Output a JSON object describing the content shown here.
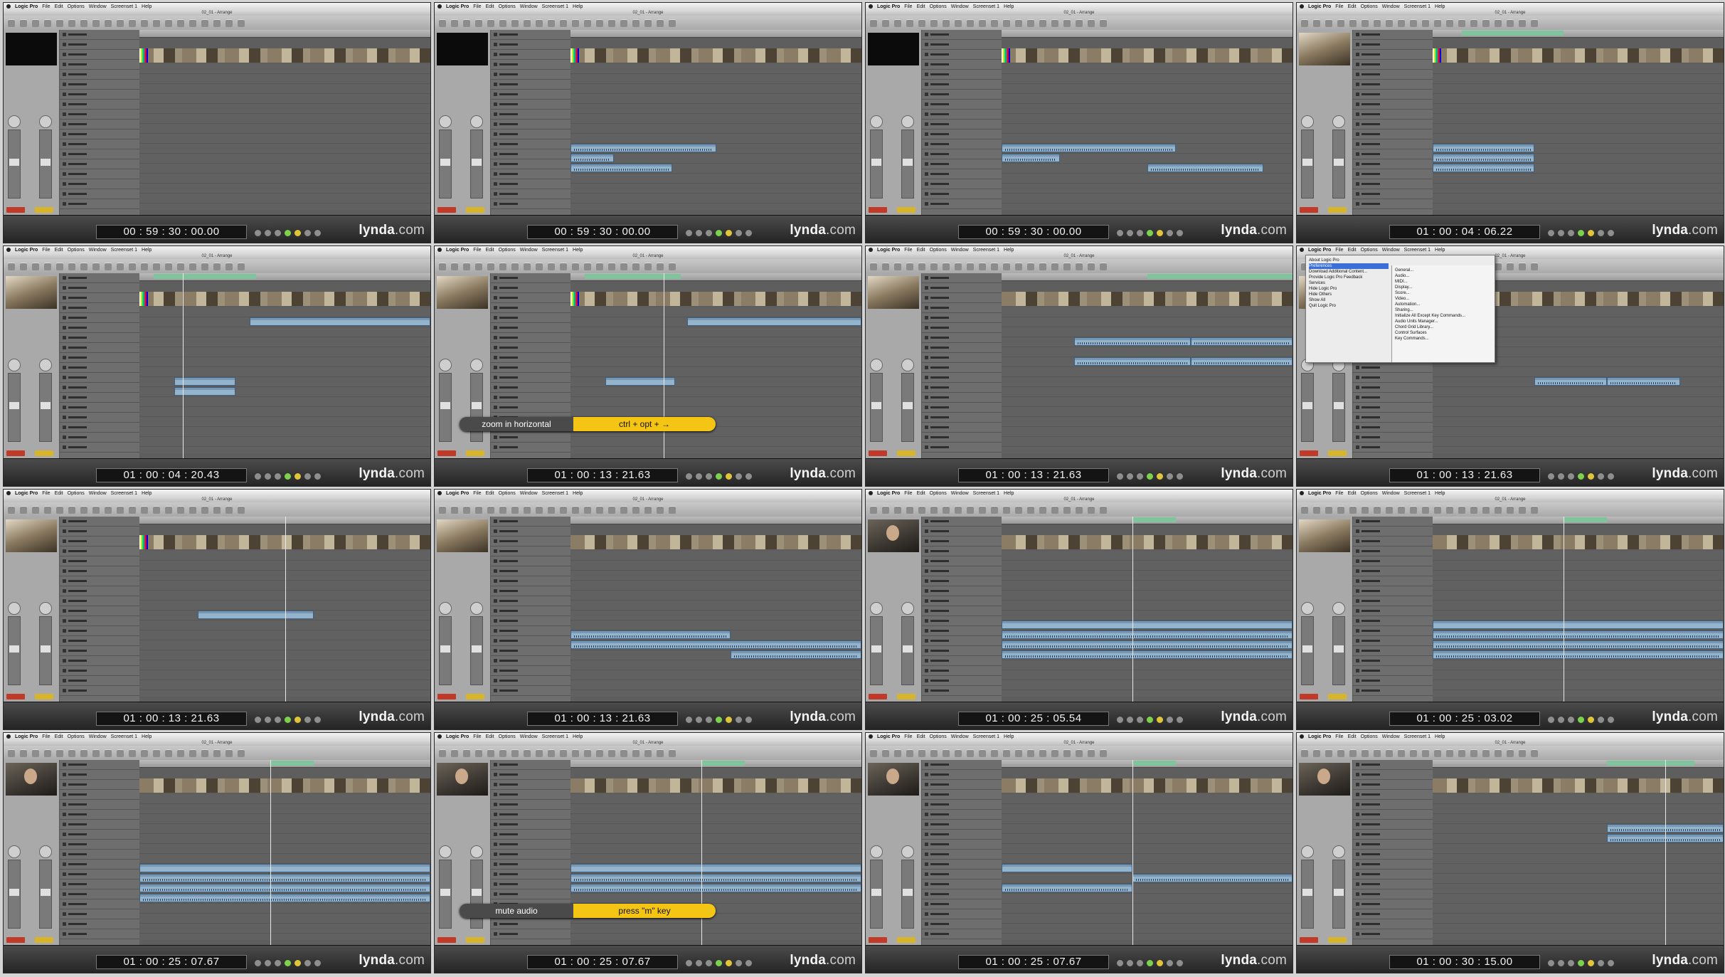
{
  "menu": {
    "app_name": "Logic Pro",
    "items": [
      "File",
      "Edit",
      "Options",
      "Window",
      "Screenset 1",
      "Help"
    ]
  },
  "window_title": "02_01 - Arrange",
  "logo": {
    "main": "lynda",
    "suffix": ".com"
  },
  "thumbnails": [
    {
      "timecode": "00 : 59 : 30 : 00.00",
      "video": "black",
      "bars": true,
      "cycle": null,
      "playhead": null,
      "regions": []
    },
    {
      "timecode": "00 : 59 : 30 : 00.00",
      "video": "black",
      "bars": true,
      "cycle": null,
      "playhead": null,
      "regions": [
        [
          0,
          8,
          0.5,
          0.62
        ],
        [
          0,
          9,
          0.15,
          0.85
        ],
        [
          0,
          10,
          0.35,
          1.0
        ]
      ]
    },
    {
      "timecode": "00 : 59 : 30 : 00.00",
      "video": "black",
      "bars": true,
      "cycle": null,
      "playhead": null,
      "regions": [
        [
          0,
          8,
          0.6,
          0.8
        ],
        [
          0,
          9,
          0.2,
          1.0
        ],
        [
          0.5,
          10,
          0.9,
          1.0
        ]
      ]
    },
    {
      "timecode": "01 : 00 : 04 : 06.22",
      "video": "room",
      "bars": true,
      "cycle": [
        0.1,
        0.45
      ],
      "playhead": null,
      "regions": [
        [
          0,
          8,
          0.35,
          1.0
        ],
        [
          0,
          9,
          0.35,
          1.0
        ],
        [
          0,
          10,
          0.35,
          1.0
        ]
      ]
    },
    {
      "timecode": "01 : 00 : 04 : 20.43",
      "video": "room",
      "bars": true,
      "cycle": [
        0.05,
        0.4
      ],
      "playhead": 0.15,
      "regions": [
        [
          0.38,
          1,
          1.0,
          0
        ],
        [
          0.12,
          7,
          0.33,
          0
        ],
        [
          0.12,
          8,
          0.33,
          0
        ]
      ]
    },
    {
      "timecode": "01 : 00 : 13 : 21.63",
      "video": "room",
      "bars": true,
      "cycle": [
        0.05,
        0.38
      ],
      "playhead": 0.32,
      "regions": [
        [
          0.4,
          1,
          1.0,
          0
        ],
        [
          0.12,
          7,
          0.36,
          0
        ]
      ]
    },
    {
      "timecode": "01 : 00 : 13 : 21.63",
      "video": "room",
      "bars": false,
      "cycle": [
        0.5,
        1.0
      ],
      "playhead": null,
      "regions": [
        [
          0.25,
          3,
          0.65,
          1
        ],
        [
          0.25,
          5,
          0.65,
          1
        ],
        [
          0.65,
          3,
          1.0,
          1
        ],
        [
          0.65,
          5,
          1.0,
          1
        ]
      ]
    },
    {
      "timecode": "01 : 00 : 13 : 21.63",
      "video": "room",
      "bars": false,
      "cycle": null,
      "playhead": null,
      "regions": [
        [
          0.35,
          7,
          0.6,
          1
        ],
        [
          0.6,
          7,
          0.85,
          1
        ]
      ]
    },
    {
      "timecode": "01 : 00 : 13 : 21.63",
      "video": "room",
      "bars": true,
      "cycle": null,
      "playhead": 0.5,
      "regions": [
        [
          0.2,
          6,
          0.6,
          0
        ]
      ]
    },
    {
      "timecode": "01 : 00 : 13 : 21.63",
      "video": "room",
      "bars": false,
      "cycle": null,
      "playhead": null,
      "regions": [
        [
          0,
          8,
          0.55,
          1
        ],
        [
          0,
          9,
          1.0,
          1
        ],
        [
          0.55,
          10,
          1.0,
          1
        ]
      ]
    },
    {
      "timecode": "01 : 00 : 25 : 05.54",
      "video": "person",
      "bars": false,
      "cycle": [
        0.45,
        0.6
      ],
      "playhead": 0.45,
      "regions": [
        [
          0,
          7,
          1.0,
          0
        ],
        [
          0,
          8,
          1.0,
          1
        ],
        [
          0,
          9,
          1.0,
          1
        ],
        [
          0,
          10,
          1.0,
          1
        ]
      ]
    },
    {
      "timecode": "01 : 00 : 25 : 03.02",
      "video": "room",
      "bars": false,
      "cycle": [
        0.45,
        0.6
      ],
      "playhead": 0.45,
      "regions": [
        [
          0,
          7,
          1.0,
          0
        ],
        [
          0,
          8,
          1.0,
          1
        ],
        [
          0,
          9,
          1.0,
          1
        ],
        [
          0,
          10,
          1.0,
          1
        ]
      ]
    },
    {
      "timecode": "01 : 00 : 25 : 07.67",
      "video": "person",
      "bars": false,
      "cycle": [
        0.45,
        0.6
      ],
      "playhead": 0.45,
      "regions": [
        [
          0,
          7,
          1.0,
          0
        ],
        [
          0,
          8,
          1.0,
          1
        ],
        [
          0,
          9,
          1.0,
          1
        ],
        [
          0,
          10,
          1.0,
          1
        ]
      ]
    },
    {
      "timecode": "01 : 00 : 25 : 07.67",
      "video": "person",
      "bars": false,
      "cycle": [
        0.45,
        0.6
      ],
      "playhead": 0.45,
      "regions": [
        [
          0,
          7,
          1.0,
          0
        ],
        [
          0,
          8,
          1.0,
          1
        ],
        [
          0,
          9,
          1.0,
          1
        ]
      ]
    },
    {
      "timecode": "01 : 00 : 25 : 07.67",
      "video": "person",
      "bars": false,
      "cycle": [
        0.45,
        0.6
      ],
      "playhead": 0.45,
      "regions": [
        [
          0,
          7,
          0.45,
          0
        ],
        [
          0.45,
          8,
          1.0,
          1
        ],
        [
          0,
          9,
          0.45,
          1
        ]
      ]
    },
    {
      "timecode": "01 : 00 : 30 : 15.00",
      "video": "person",
      "bars": false,
      "cycle": [
        0.6,
        0.9
      ],
      "playhead": 0.8,
      "regions": [
        [
          0.6,
          3,
          1.0,
          1
        ],
        [
          0.6,
          4,
          1.0,
          1
        ]
      ]
    }
  ],
  "overlays": {
    "5": {
      "action": "zoom in horizontal",
      "shortcut": "ctrl + opt + →"
    },
    "13": {
      "action": "mute audio",
      "shortcut": "press \"m\" key"
    }
  },
  "app_menu": {
    "items": [
      "About Logic Pro",
      "Preferences",
      "Download Additional Content...",
      "Provide Logic Pro Feedback",
      "Services",
      "Hide Logic Pro",
      "Hide Others",
      "Show All",
      "Quit Logic Pro"
    ],
    "submenu": [
      "General...",
      "Audio...",
      "MIDI...",
      "Display...",
      "Score...",
      "Video...",
      "Automation...",
      "Sharing...",
      "Initialize All Except Key Commands...",
      "Audio Units Manager...",
      "Chord Grid Library...",
      "Control Surfaces",
      "Key Commands..."
    ]
  }
}
